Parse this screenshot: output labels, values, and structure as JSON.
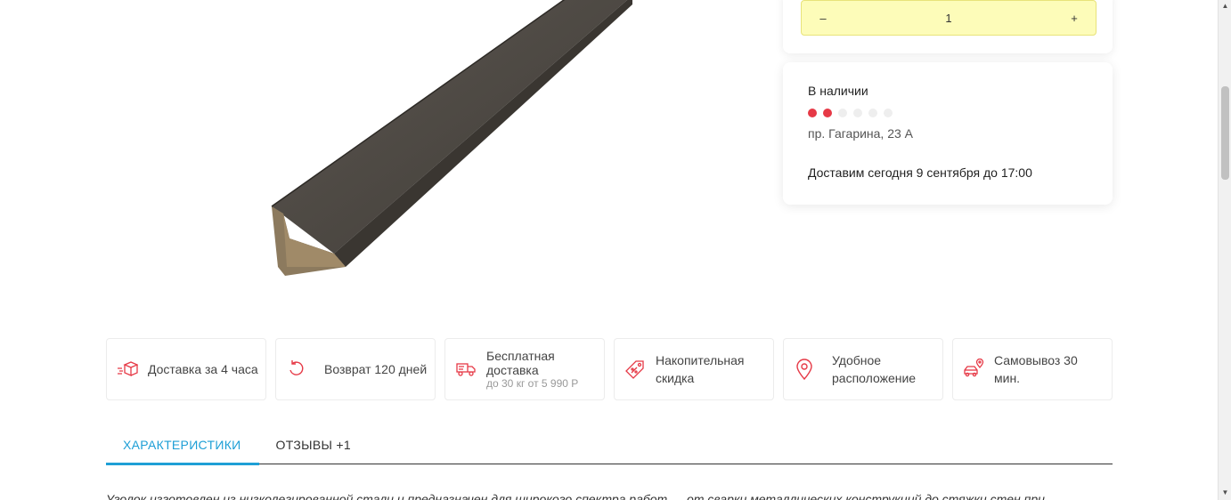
{
  "quantity": {
    "minus_label": "–",
    "value": "1",
    "plus_label": "+"
  },
  "stock": {
    "status": "В наличии",
    "level_filled": 2,
    "level_total": 6,
    "address": "пр. Гагарина, 23 А",
    "delivery": "Доставим сегодня 9 сентября до 17:00"
  },
  "features": [
    {
      "icon": "delivery-box-icon",
      "label": "Доставка за 4 часа"
    },
    {
      "icon": "return-icon",
      "label": "Возврат 120 дней"
    },
    {
      "icon": "truck-icon",
      "label": "Бесплатная доставка",
      "sub": "до 30 кг от 5 990 Р"
    },
    {
      "icon": "discount-tag-icon",
      "label": "Накопительная скидка"
    },
    {
      "icon": "location-pin-icon",
      "label": "Удобное расположение"
    },
    {
      "icon": "car-pickup-icon",
      "label": "Самовывоз 30 мин."
    }
  ],
  "tabs": [
    {
      "label": "ХАРАКТЕРИСТИКИ",
      "active": true
    },
    {
      "label": "ОТЗЫВЫ +1",
      "active": false
    }
  ],
  "description": "Уголок изготовлен из низколегированной стали и предназначен для широкого спектра работ — от сварки металлических конструкций до стяжки стен при",
  "colors": {
    "accent": "#e63946",
    "tab_active": "#1e9fd6",
    "stepper_bg": "#fdfcb9"
  }
}
